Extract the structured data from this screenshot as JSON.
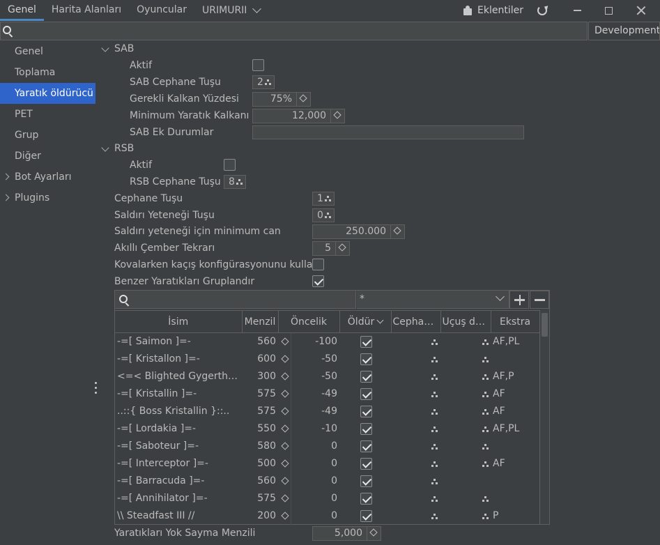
{
  "topbar": {
    "tabs": [
      "Genel",
      "Harita Alanları",
      "Oyuncular"
    ],
    "profile": "URIMURII",
    "extensions_label": "Eklentiler"
  },
  "search": {
    "placeholder": ""
  },
  "dev_button": "Development",
  "sidebar": {
    "items": [
      "Genel",
      "Toplama",
      "Yaratık öldürücü",
      "PET",
      "Grup",
      "Diğer",
      "Bot Ayarları",
      "Plugins"
    ],
    "selected": "Yaratık öldürücü"
  },
  "sab": {
    "title": "SAB",
    "aktif_label": "Aktif",
    "aktif": false,
    "ammo_key_label": "SAB Cephane Tuşu",
    "ammo_key": "2",
    "shield_pct_label": "Gerekli Kalkan Yüzdesi",
    "shield_pct": "75%",
    "min_shield_label": "Minimum Yaratık Kalkanı",
    "min_shield": "12,000",
    "extra_label": "SAB Ek Durumlar",
    "extra": ""
  },
  "rsb": {
    "title": "RSB",
    "aktif_label": "Aktif",
    "aktif": false,
    "ammo_key_label": "RSB Cephane Tuşu",
    "ammo_key": "8"
  },
  "settings": {
    "ammo_key_label": "Cephane Tuşu",
    "ammo_key": "1",
    "attack_skill_label": "Saldırı Yeteneği Tuşu",
    "attack_skill": "0",
    "min_hp_label": "Saldırı yeteneği için minimum can",
    "min_hp": "250.000",
    "circle_label": "Akıllı Çember Tekrarı",
    "circle": "5",
    "escape_label": "Kovalarken kaçış konfigürasyonunu kullan",
    "escape": false,
    "group_label": "Benzer Yaratıkları Gruplandır",
    "group": true,
    "ignore_range_label": "Yaratıkları Yok Sayma Menzili",
    "ignore_range": "5,000"
  },
  "table": {
    "filter": "*",
    "headers": [
      "İsim",
      "Menzil",
      "Öncelik",
      "Öldür",
      "Cephane...",
      "Uçuş dü...",
      "Ekstra"
    ],
    "rows": [
      {
        "name": "-=[ Saimon ]=-",
        "range": "560",
        "priority": "-100",
        "kill": true,
        "ekstra": "AF,PL",
        "ucus": true
      },
      {
        "name": "-=[ Kristallon ]=-",
        "range": "600",
        "priority": "-50",
        "kill": true,
        "ekstra": "",
        "ucus": true
      },
      {
        "name": "<=< Blighted Gygerthrall >=>",
        "range": "300",
        "priority": "-50",
        "kill": true,
        "ekstra": "AF,P",
        "ucus": true
      },
      {
        "name": "-=[ Kristallin ]=-",
        "range": "575",
        "priority": "-49",
        "kill": true,
        "ekstra": "AF",
        "ucus": true
      },
      {
        "name": "..::{ Boss Kristallin }::..",
        "range": "575",
        "priority": "-49",
        "kill": true,
        "ekstra": "AF",
        "ucus": true
      },
      {
        "name": "-=[ Lordakia ]=-",
        "range": "550",
        "priority": "-10",
        "kill": true,
        "ekstra": "AF,PL",
        "ucus": true
      },
      {
        "name": "-=[ Saboteur ]=-",
        "range": "580",
        "priority": "0",
        "kill": true,
        "ekstra": "",
        "ucus": true
      },
      {
        "name": "-=[ Interceptor ]=-",
        "range": "500",
        "priority": "0",
        "kill": true,
        "ekstra": "AF",
        "ucus": true
      },
      {
        "name": "-=[ Barracuda ]=-",
        "range": "560",
        "priority": "0",
        "kill": true,
        "ekstra": "",
        "ucus": false
      },
      {
        "name": "-=[ Annihilator ]=-",
        "range": "575",
        "priority": "0",
        "kill": true,
        "ekstra": "",
        "ucus": true
      },
      {
        "name": "\\\\ Steadfast III //",
        "range": "200",
        "priority": "0",
        "kill": true,
        "ekstra": "P",
        "ucus": true
      }
    ]
  }
}
